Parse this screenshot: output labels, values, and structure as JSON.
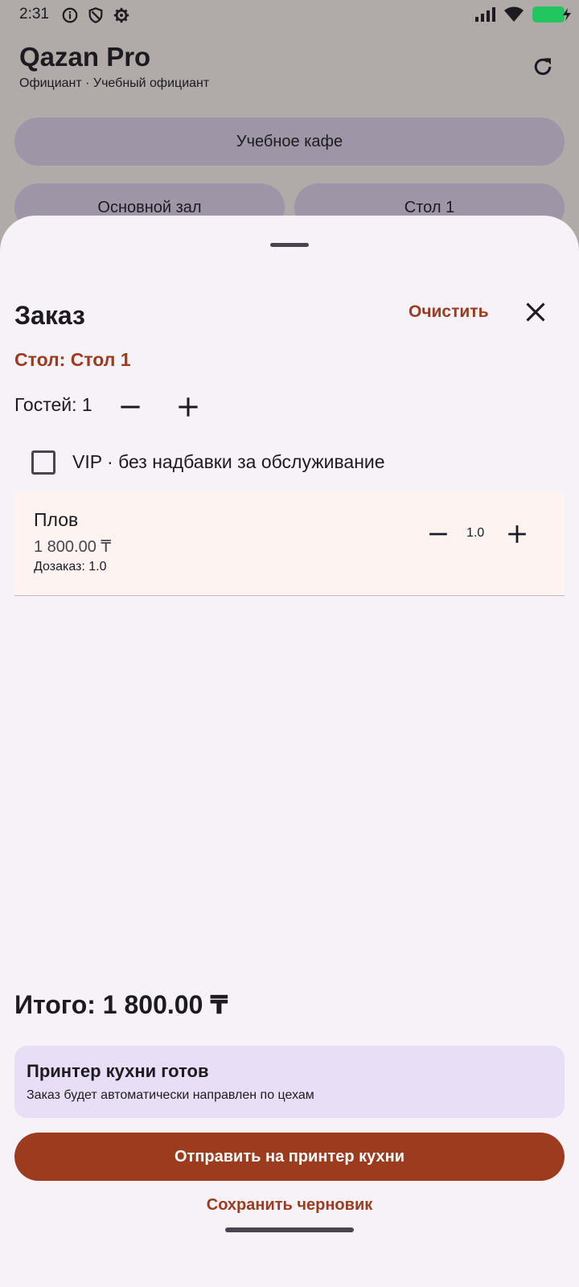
{
  "status_bar": {
    "time": "2:31",
    "icons": [
      "info-icon",
      "shield-icon",
      "settings-icon",
      "signal-icon",
      "wifi-icon",
      "battery-icon"
    ],
    "battery_color": "#22c55e"
  },
  "app": {
    "title": "Qazan Pro",
    "subtitle": "Официант · Учебный официант",
    "cafe_selector": "Учебное кафе",
    "hall_selector": "Основной зал",
    "table_selector": "Стол 1"
  },
  "sheet": {
    "title": "Заказ",
    "clear_label": "Очистить",
    "table_label": "Стол: Стол 1",
    "guests_label": "Гостей: 1",
    "vip_label": "VIP · без надбавки за обслуживание",
    "vip_checked": false,
    "items": [
      {
        "name": "Плов",
        "price": "1 800.00 ₸",
        "reorder": "Дозаказ: 1.0",
        "qty": "1.0"
      }
    ],
    "total": "Итого: 1 800.00 ₸",
    "printer": {
      "title": "Принтер кухни готов",
      "subtitle": "Заказ будет автоматически направлен по цехам"
    },
    "send_label": "Отправить на принтер кухни",
    "draft_label": "Сохранить черновик"
  },
  "colors": {
    "accent": "#9c3b1e",
    "sheet_bg": "#f6f2f8",
    "card_bg": "#e8dff6",
    "item_bg": "#fdf4f2",
    "scrim_bg": "#b0aaa8",
    "pill_bg": "#9e96a6"
  }
}
